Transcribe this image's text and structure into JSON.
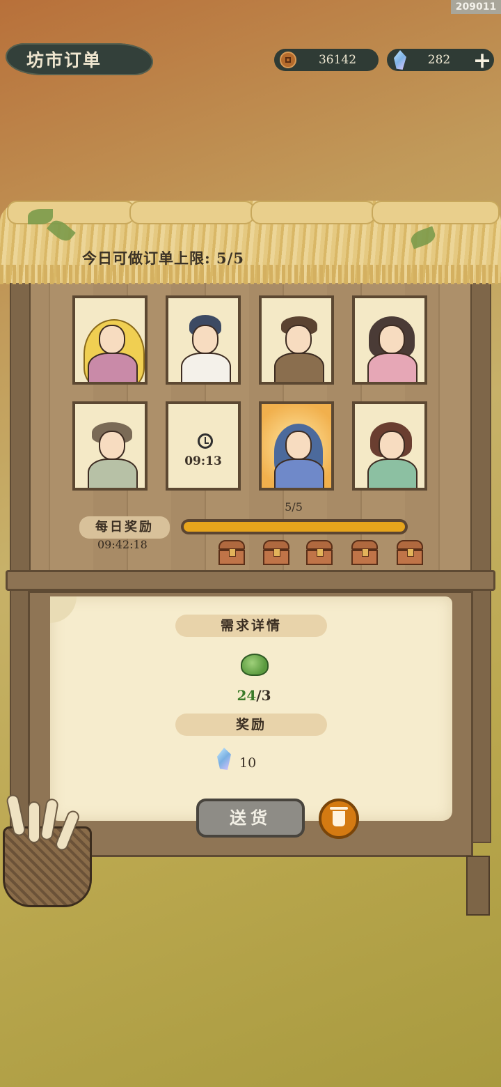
{
  "build_id": "209011",
  "header": {
    "title": "坊市订单",
    "coins": "36142",
    "gems": "282",
    "add_label": "+"
  },
  "icons": {
    "coin": "coin-icon",
    "gem": "gem-icon",
    "timer": "clock-icon",
    "chest": "chest-icon",
    "trash": "trash-icon",
    "item": "cabbage-icon"
  },
  "stall": {
    "daily_limit_text": "今日可做订单上限: 5/5",
    "slots": [
      {
        "type": "customer",
        "name": "blonde-dancer"
      },
      {
        "type": "customer",
        "name": "boy-scholar"
      },
      {
        "type": "customer",
        "name": "old-farmer"
      },
      {
        "type": "customer",
        "name": "girl-buns"
      },
      {
        "type": "customer",
        "name": "village-woman"
      },
      {
        "type": "timer",
        "time": "09:13"
      },
      {
        "type": "customer",
        "name": "blue-robed-lady",
        "selected": true
      },
      {
        "type": "customer",
        "name": "tea-lady"
      }
    ]
  },
  "daily_reward": {
    "label": "每日奖励",
    "timer": "09:42:18",
    "progress_text": "5/5",
    "progress": 1.0,
    "chest_count": 5
  },
  "order": {
    "demand_title": "需求详情",
    "have": "24",
    "need": "/3",
    "reward_title": "奖励",
    "reward_amount": "10"
  },
  "actions": {
    "deliver_label": "送货"
  },
  "colors": {
    "progress_fill": "#e7a51c",
    "have_count": "#3a7a28",
    "trash_button": "#d47a12"
  }
}
